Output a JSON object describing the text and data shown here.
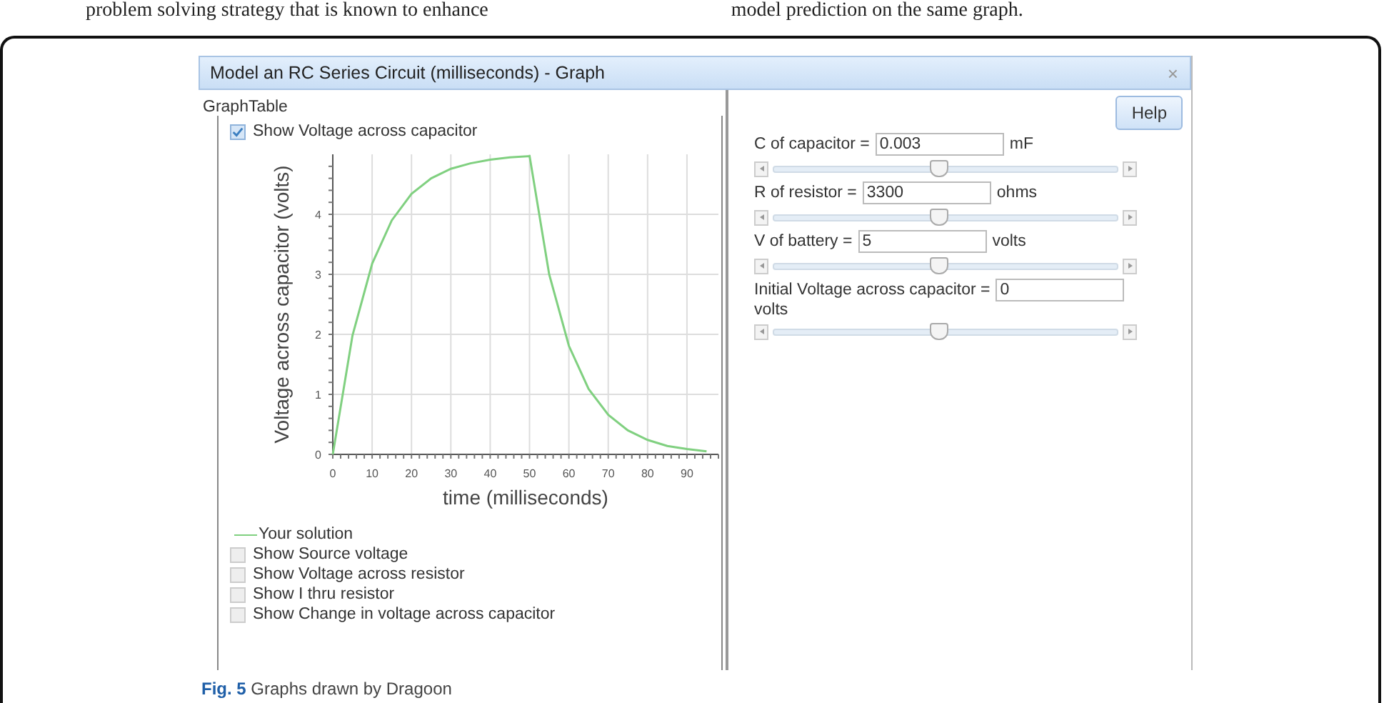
{
  "page_text": {
    "left": "problem solving strategy that is known to enhance",
    "right": "model prediction on the same graph."
  },
  "window": {
    "title": "Model an RC Series Circuit (milliseconds) - Graph",
    "close": "×"
  },
  "graph_panel": {
    "tab_label": "GraphTable",
    "main_toggle": {
      "label": "Show Voltage across capacitor",
      "checked": true
    },
    "chart_data": {
      "type": "line",
      "xlabel": "time (milliseconds)",
      "ylabel": "Voltage across capacitor (volts)",
      "x": [
        0,
        5,
        10,
        15,
        20,
        25,
        30,
        35,
        40,
        45,
        50,
        55,
        60,
        65,
        70,
        75,
        80,
        85,
        90,
        95
      ],
      "series": [
        {
          "name": "Your solution",
          "color": "#80d080",
          "values": [
            0,
            1.98,
            3.18,
            3.9,
            4.34,
            4.6,
            4.76,
            4.85,
            4.91,
            4.95,
            4.97,
            3.0,
            1.81,
            1.09,
            0.66,
            0.4,
            0.24,
            0.14,
            0.09,
            0.05
          ]
        }
      ],
      "xlim": [
        0,
        98
      ],
      "ylim": [
        0,
        5
      ],
      "grid": true,
      "xticks": [
        0,
        10,
        20,
        30,
        40,
        50,
        60,
        70,
        80,
        90
      ],
      "yticks": [
        0,
        1,
        2,
        3,
        4
      ]
    },
    "toggles": [
      {
        "label": "Show Source voltage",
        "checked": false
      },
      {
        "label": "Show Voltage across resistor",
        "checked": false
      },
      {
        "label": "Show I thru resistor",
        "checked": false
      },
      {
        "label": "Show Change in voltage across capacitor",
        "checked": false
      }
    ]
  },
  "parameters_panel": {
    "help_button": "Help",
    "parameters": [
      {
        "label": "C of capacitor =",
        "value": "0.003",
        "unit": "mF",
        "level": 0.48
      },
      {
        "label": "R of resistor =",
        "value": "3300",
        "unit": "ohms",
        "level": 0.48
      },
      {
        "label": "V of battery =",
        "value": "5",
        "unit": "volts",
        "level": 0.48
      },
      {
        "label": "Initial Voltage across capacitor =",
        "value": "0",
        "unit": "volts",
        "level": 0.48
      }
    ]
  },
  "caption": "**Fig. 5** Graphs drawn by Dragoon"
}
